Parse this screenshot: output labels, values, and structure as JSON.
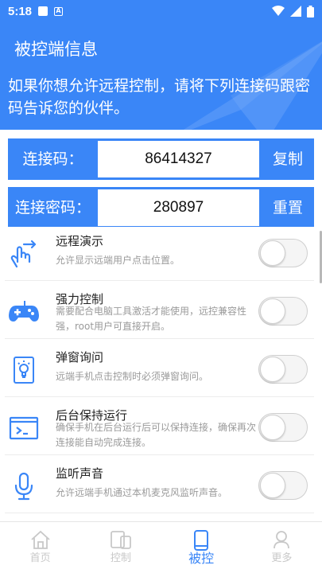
{
  "status_bar": {
    "time": "5:18"
  },
  "header": {
    "title": "被控端信息",
    "description": "如果你想允许远程控制，请将下列连接码跟密码告诉您的伙伴。"
  },
  "connection": {
    "code_label": "连接码：",
    "code_value": "86414327",
    "copy_label": "复制",
    "password_label": "连接密码：",
    "password_value": "280897",
    "reset_label": "重置"
  },
  "settings": [
    {
      "title": "远程演示",
      "subtitle": "允许显示远端用户点击位置。",
      "enabled": false,
      "icon": "touch-gesture-icon"
    },
    {
      "title": "强力控制",
      "subtitle": "需要配合电脑工具激活才能使用，远控兼容性强，root用户可直接开启。",
      "enabled": false,
      "icon": "gamepad-icon"
    },
    {
      "title": "弹窗询问",
      "subtitle": "远端手机点击控制时必须弹窗询问。",
      "enabled": false,
      "icon": "lightbulb-icon"
    },
    {
      "title": "后台保持运行",
      "subtitle": "确保手机在后台运行后可以保持连接，确保再次连接能自动完成连接。",
      "enabled": false,
      "icon": "terminal-icon"
    },
    {
      "title": "监听声音",
      "subtitle": "允许远端手机通过本机麦克风监听声音。",
      "enabled": false,
      "icon": "microphone-icon"
    }
  ],
  "nav": [
    {
      "label": "首页",
      "icon": "home-icon",
      "active": false
    },
    {
      "label": "控制",
      "icon": "devices-icon",
      "active": false
    },
    {
      "label": "被控",
      "icon": "phone-icon",
      "active": true
    },
    {
      "label": "更多",
      "icon": "person-icon",
      "active": false
    }
  ],
  "colors": {
    "accent": "#3a86f7",
    "text": "#222222",
    "muted": "#9a9a9a"
  }
}
